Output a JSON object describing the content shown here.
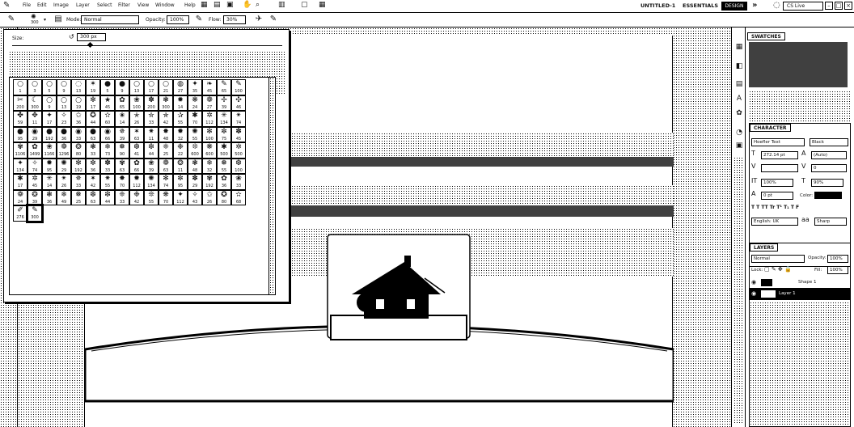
{
  "menubar": {
    "items": [
      "File",
      "Edit",
      "Image",
      "Layer",
      "Select",
      "Filter",
      "View",
      "Window",
      "Help"
    ],
    "document_title": "UNTITLED-1",
    "workspace": "ESSENTIALS",
    "design": "DESIGN",
    "search_placeholder": "CS Live"
  },
  "options": {
    "brush_size_preview": "300",
    "mode_label": "Mode:",
    "mode_value": "Normal",
    "opacity_label": "Opacity:",
    "opacity_value": "100%",
    "flow_label": "Flow:",
    "flow_value": "30%"
  },
  "brush_picker": {
    "size_label": "Size:",
    "size_value": "300 px",
    "size_fraction": 0.28,
    "brushes": [
      {
        "g": "○",
        "n": "1"
      },
      {
        "g": "○",
        "n": "3"
      },
      {
        "g": "○",
        "n": "5"
      },
      {
        "g": "○",
        "n": "9"
      },
      {
        "g": "◌",
        "n": "13"
      },
      {
        "g": "✶",
        "n": "19"
      },
      {
        "g": "●",
        "n": "5"
      },
      {
        "g": "●",
        "n": "9"
      },
      {
        "g": "○",
        "n": "13"
      },
      {
        "g": "○",
        "n": "17"
      },
      {
        "g": "○",
        "n": "21"
      },
      {
        "g": "◍",
        "n": "27"
      },
      {
        "g": "✦",
        "n": "35"
      },
      {
        "g": "❧",
        "n": "45"
      },
      {
        "g": "✎",
        "n": "65"
      },
      {
        "g": "✎",
        "n": "100"
      },
      {
        "g": "✂",
        "n": "200"
      },
      {
        "g": "☾",
        "n": "300"
      },
      {
        "g": "○",
        "n": "9"
      },
      {
        "g": "○",
        "n": "13"
      },
      {
        "g": "○",
        "n": "19"
      },
      {
        "g": "✻",
        "n": "17"
      },
      {
        "g": "★",
        "n": "45"
      },
      {
        "g": "✿",
        "n": "65"
      },
      {
        "g": "❀",
        "n": "100"
      },
      {
        "g": "✽",
        "n": "200"
      },
      {
        "g": "❃",
        "n": "300"
      },
      {
        "g": "✹",
        "n": "14"
      },
      {
        "g": "❋",
        "n": "24"
      },
      {
        "g": "❁",
        "n": "27"
      },
      {
        "g": "✢",
        "n": "39"
      },
      {
        "g": "✣",
        "n": "46"
      },
      {
        "g": "✤",
        "n": "59"
      },
      {
        "g": "✥",
        "n": "11"
      },
      {
        "g": "✦",
        "n": "17"
      },
      {
        "g": "✧",
        "n": "23"
      },
      {
        "g": "✩",
        "n": "36"
      },
      {
        "g": "✪",
        "n": "44"
      },
      {
        "g": "✫",
        "n": "60"
      },
      {
        "g": "✬",
        "n": "14"
      },
      {
        "g": "✭",
        "n": "26"
      },
      {
        "g": "✮",
        "n": "33"
      },
      {
        "g": "✯",
        "n": "42"
      },
      {
        "g": "✰",
        "n": "55"
      },
      {
        "g": "✱",
        "n": "70"
      },
      {
        "g": "✲",
        "n": "112"
      },
      {
        "g": "✳",
        "n": "134"
      },
      {
        "g": "✴",
        "n": "74"
      },
      {
        "g": "●",
        "n": "95"
      },
      {
        "g": "◉",
        "n": "29"
      },
      {
        "g": "●",
        "n": "192"
      },
      {
        "g": "●",
        "n": "36"
      },
      {
        "g": "◉",
        "n": "33"
      },
      {
        "g": "●",
        "n": "63"
      },
      {
        "g": "◉",
        "n": "66"
      },
      {
        "g": "✵",
        "n": "39"
      },
      {
        "g": "✶",
        "n": "63"
      },
      {
        "g": "✷",
        "n": "11"
      },
      {
        "g": "✸",
        "n": "48"
      },
      {
        "g": "✹",
        "n": "32"
      },
      {
        "g": "✺",
        "n": "55"
      },
      {
        "g": "✻",
        "n": "100"
      },
      {
        "g": "✼",
        "n": "75"
      },
      {
        "g": "✽",
        "n": "45"
      },
      {
        "g": "✾",
        "n": "1106"
      },
      {
        "g": "✿",
        "n": "1499"
      },
      {
        "g": "❀",
        "n": "1166"
      },
      {
        "g": "❁",
        "n": "1296"
      },
      {
        "g": "❂",
        "n": "80"
      },
      {
        "g": "❃",
        "n": "33"
      },
      {
        "g": "❄",
        "n": "73"
      },
      {
        "g": "❅",
        "n": "90"
      },
      {
        "g": "❆",
        "n": "41"
      },
      {
        "g": "❇",
        "n": "44"
      },
      {
        "g": "❈",
        "n": "25"
      },
      {
        "g": "❉",
        "n": "22"
      },
      {
        "g": "❊",
        "n": "600"
      },
      {
        "g": "❋",
        "n": "600"
      },
      {
        "g": "✱",
        "n": "500"
      },
      {
        "g": "✲",
        "n": "500"
      },
      {
        "g": "✦",
        "n": "134"
      },
      {
        "g": "✧",
        "n": "74"
      },
      {
        "g": "✹",
        "n": "95"
      },
      {
        "g": "✺",
        "n": "29"
      },
      {
        "g": "✻",
        "n": "192"
      },
      {
        "g": "✼",
        "n": "36"
      },
      {
        "g": "✽",
        "n": "33"
      },
      {
        "g": "✾",
        "n": "63"
      },
      {
        "g": "✿",
        "n": "66"
      },
      {
        "g": "❀",
        "n": "39"
      },
      {
        "g": "❁",
        "n": "63"
      },
      {
        "g": "❂",
        "n": "11"
      },
      {
        "g": "❃",
        "n": "48"
      },
      {
        "g": "❄",
        "n": "32"
      },
      {
        "g": "❅",
        "n": "55"
      },
      {
        "g": "❆",
        "n": "100"
      },
      {
        "g": "✱",
        "n": "17"
      },
      {
        "g": "✲",
        "n": "45"
      },
      {
        "g": "✳",
        "n": "14"
      },
      {
        "g": "✴",
        "n": "26"
      },
      {
        "g": "✵",
        "n": "33"
      },
      {
        "g": "✶",
        "n": "42"
      },
      {
        "g": "✷",
        "n": "55"
      },
      {
        "g": "✸",
        "n": "70"
      },
      {
        "g": "✹",
        "n": "112"
      },
      {
        "g": "✺",
        "n": "134"
      },
      {
        "g": "✻",
        "n": "74"
      },
      {
        "g": "✼",
        "n": "95"
      },
      {
        "g": "✽",
        "n": "29"
      },
      {
        "g": "✾",
        "n": "192"
      },
      {
        "g": "✿",
        "n": "36"
      },
      {
        "g": "❀",
        "n": "33"
      },
      {
        "g": "❁",
        "n": "24"
      },
      {
        "g": "❂",
        "n": "39"
      },
      {
        "g": "❃",
        "n": "36"
      },
      {
        "g": "❄",
        "n": "49"
      },
      {
        "g": "❅",
        "n": "25"
      },
      {
        "g": "❆",
        "n": "63"
      },
      {
        "g": "❇",
        "n": "44"
      },
      {
        "g": "❈",
        "n": "33"
      },
      {
        "g": "❉",
        "n": "42"
      },
      {
        "g": "❊",
        "n": "55"
      },
      {
        "g": "❋",
        "n": "70"
      },
      {
        "g": "✦",
        "n": "112"
      },
      {
        "g": "✧",
        "n": "43"
      },
      {
        "g": "✩",
        "n": "26"
      },
      {
        "g": "✪",
        "n": "80"
      },
      {
        "g": "✫",
        "n": "68"
      },
      {
        "g": "✐",
        "n": "276"
      },
      {
        "g": "✎",
        "n": "300"
      }
    ],
    "selected_index": 129
  },
  "right_panels": {
    "swatches_tab": "SWATCHES",
    "character_tab": "CHARACTER",
    "font_family": "Hoefler Text",
    "font_style": "Black",
    "font_size": "272.14 pt",
    "leading": "(Auto)",
    "kerning": "",
    "tracking": "0",
    "vscale": "100%",
    "hscale": "90%",
    "baseline": "0 pt",
    "color_label": "Color:",
    "language": "English: UK",
    "antialias": "Sharp",
    "layers_tab": "LAYERS",
    "blend_mode": "Normal",
    "opacity_label": "Opacity:",
    "opacity_value": "100%",
    "lock_label": "Lock:",
    "fill_label": "Fill:",
    "fill_value": "100%",
    "layers": [
      {
        "name": "Shape 1"
      },
      {
        "name": "Layer 1"
      }
    ]
  }
}
